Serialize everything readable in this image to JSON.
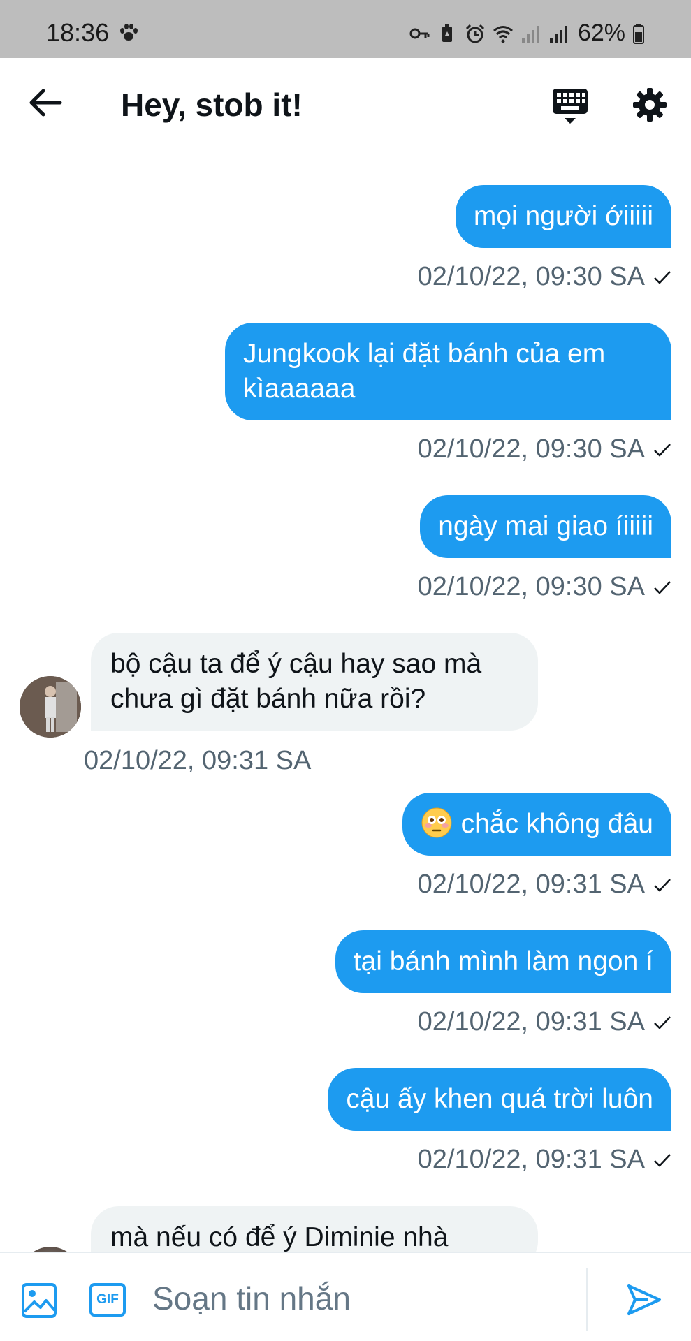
{
  "status_bar": {
    "time": "18:36",
    "battery": "62%"
  },
  "header": {
    "title": "Hey, stob it!"
  },
  "colors": {
    "accent": "#1d9bf0",
    "incoming_bubble": "#eff3f4",
    "timestamp": "#536471",
    "status_bar_bg": "#bdbdbd"
  },
  "messages": [
    {
      "direction": "out",
      "text": "mọi người ớiiiii",
      "timestamp": "02/10/22, 09:30 SA"
    },
    {
      "direction": "out",
      "text": "Jungkook lại đặt bánh của em kìaaaaaa",
      "timestamp": "02/10/22, 09:30 SA"
    },
    {
      "direction": "out",
      "text": "ngày mai giao íiiiii",
      "timestamp": "02/10/22, 09:30 SA"
    },
    {
      "direction": "in",
      "text": "bộ cậu ta để ý cậu hay sao mà chưa gì đặt bánh nữa rồi?",
      "timestamp": "02/10/22, 09:31 SA"
    },
    {
      "direction": "out",
      "text": "chắc không đâu",
      "emoji": "flushed-face",
      "timestamp": "02/10/22, 09:31 SA"
    },
    {
      "direction": "out",
      "text": "tại bánh mình làm ngon í",
      "timestamp": "02/10/22, 09:31 SA"
    },
    {
      "direction": "out",
      "text": "cậu ấy khen quá trời luôn",
      "timestamp": "02/10/22, 09:31 SA"
    },
    {
      "direction": "in",
      "text": "mà nếu có để ý Diminie nhà",
      "timestamp": ""
    }
  ],
  "composer": {
    "gif_label": "GIF",
    "placeholder": "Soạn tin nhắn"
  },
  "icons": [
    "paw-icon",
    "key-icon",
    "battery-saver-icon",
    "alarm-icon",
    "wifi-icon",
    "signal-icon",
    "back-arrow-icon",
    "keyboard-icon",
    "gear-icon",
    "image-icon",
    "send-icon",
    "checkmark-icon"
  ]
}
